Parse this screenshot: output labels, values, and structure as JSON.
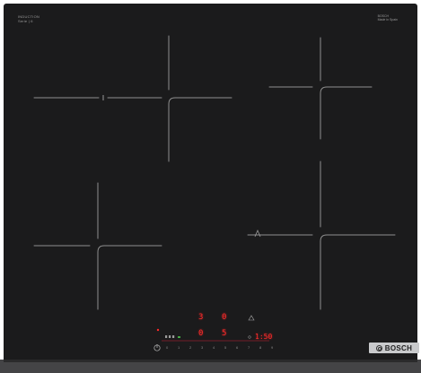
{
  "brand_top_left": {
    "line1": "INDUCTION",
    "line2": "Serie | 6"
  },
  "brand_top_right": {
    "line1": "BOSCH",
    "line2": "Made in Spain"
  },
  "controls": {
    "zone_top_left_level": "3",
    "zone_top_right_level": "0",
    "zone_left_level": "0",
    "zone_right_level": "5",
    "timer_display": "1:50",
    "slider_numbers": [
      "0",
      "1",
      "2",
      "3",
      "4",
      "5",
      "6",
      "7",
      "8",
      "9"
    ]
  },
  "logo": {
    "word": "BOSCH"
  },
  "colors": {
    "surface": "#1b1b1c",
    "display_red": "#ff2b2b",
    "logo_plate": "#c9cacc"
  }
}
